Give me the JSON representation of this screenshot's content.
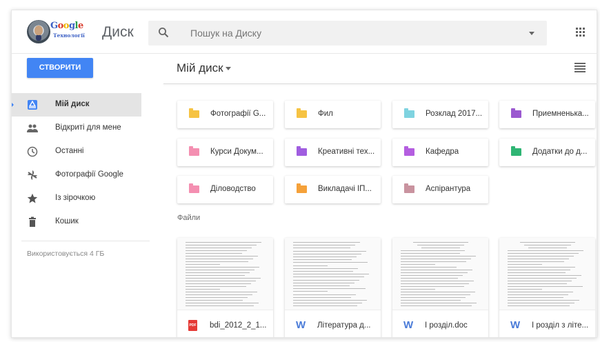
{
  "app": {
    "logo_text": "Google",
    "logo_subtitle": "Технології",
    "name": "Диск"
  },
  "search": {
    "placeholder": "Пошук на Диску"
  },
  "toolbar": {
    "create_label": "СТВОРИТИ",
    "location_title": "Мій диск"
  },
  "sidebar": {
    "items": [
      {
        "label": "Мій диск",
        "icon": "drive-icon",
        "active": true
      },
      {
        "label": "Відкриті для мене",
        "icon": "people-icon"
      },
      {
        "label": "Останні",
        "icon": "clock-icon"
      },
      {
        "label": "Фотографії Google",
        "icon": "pinwheel-icon"
      },
      {
        "label": "Із зірочкою",
        "icon": "star-icon"
      },
      {
        "label": "Кошик",
        "icon": "trash-icon"
      }
    ],
    "storage": "Використовується 4 ГБ"
  },
  "folders": [
    {
      "name": "Фотографії G...",
      "color": "#f6c343"
    },
    {
      "name": "Фил",
      "color": "#f6c343"
    },
    {
      "name": "Розклад 2017...",
      "color": "#7fd3e0"
    },
    {
      "name": "Приемненька...",
      "color": "#9b59d0"
    },
    {
      "name": "Курси Докум...",
      "color": "#f48fb1"
    },
    {
      "name": "Креативні тех...",
      "color": "#a05ee0"
    },
    {
      "name": "Кафедра",
      "color": "#b45ee0"
    },
    {
      "name": "Додатки до д...",
      "color": "#2fb574"
    },
    {
      "name": "Діловодство",
      "color": "#f48fb1"
    },
    {
      "name": "Викладачі ІП...",
      "color": "#f5a13a"
    },
    {
      "name": "Аспірантура",
      "color": "#c9939f"
    }
  ],
  "files_label": "Файли",
  "files": [
    {
      "name": "bdi_2012_2_1...",
      "type": "pdf",
      "type_label": "PDF"
    },
    {
      "name": "Література д...",
      "type": "word",
      "type_label": "W"
    },
    {
      "name": "І розділ.doc",
      "type": "word",
      "type_label": "W"
    },
    {
      "name": "І розділ з літе...",
      "type": "word",
      "type_label": "W"
    }
  ],
  "colors": {
    "accent": "#4285f4",
    "pdf": "#e53935",
    "word": "#4a7bd8"
  }
}
